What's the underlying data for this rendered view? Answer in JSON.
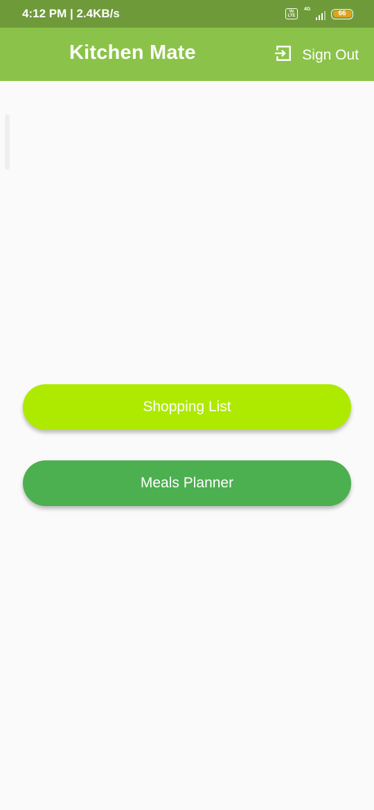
{
  "status_bar": {
    "time_speed": "4:12 PM | 2.4KB/s",
    "volte_label": "Vo LTE",
    "network_label": "4G",
    "battery_level": "66",
    "battery_color": "#e2a21d"
  },
  "app_bar": {
    "title": "Kitchen Mate",
    "sign_out_label": "Sign Out",
    "sign_out_icon": "exit-icon",
    "color": "#8bc34a"
  },
  "buttons": [
    {
      "label": "Shopping List",
      "color": "#aeea00"
    },
    {
      "label": "Meals Planner",
      "color": "#4caf50"
    }
  ]
}
